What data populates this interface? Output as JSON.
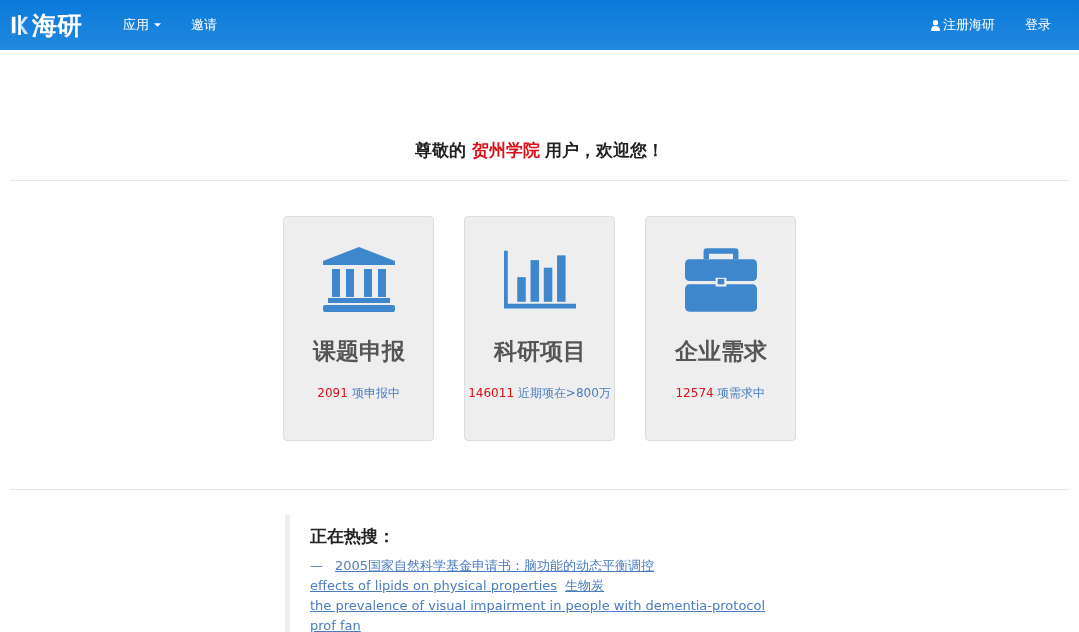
{
  "navbar": {
    "logo": "海研",
    "menu": [
      {
        "label": "应用",
        "dropdown": true
      },
      {
        "label": "邀请",
        "dropdown": false
      }
    ],
    "right": [
      {
        "label": "注册海研",
        "kind": "user"
      },
      {
        "label": "登录",
        "kind": "plain"
      }
    ]
  },
  "welcome": {
    "before": "尊敬的 ",
    "institution": "贺州学院",
    "after": " 用户，欢迎您！"
  },
  "cards": [
    {
      "kind": "bank",
      "title": "课题申报",
      "count": "2091",
      "caption": "项申报中"
    },
    {
      "kind": "chart",
      "title": "科研项目",
      "count": "146011",
      "caption": "近期项在>800万"
    },
    {
      "kind": "briefcase",
      "title": "企业需求",
      "count": "12574",
      "caption": "项需求中"
    }
  ],
  "hot_search": {
    "title": "正在热搜：",
    "dash": "—",
    "links": [
      "2005国家自然科学基金申请书：脑功能的动态平衡调控",
      "effects of lipids on physical properties",
      "生物炭",
      "the prevalence of visual impairment in people with dementia-protocol",
      "prof fan"
    ]
  }
}
